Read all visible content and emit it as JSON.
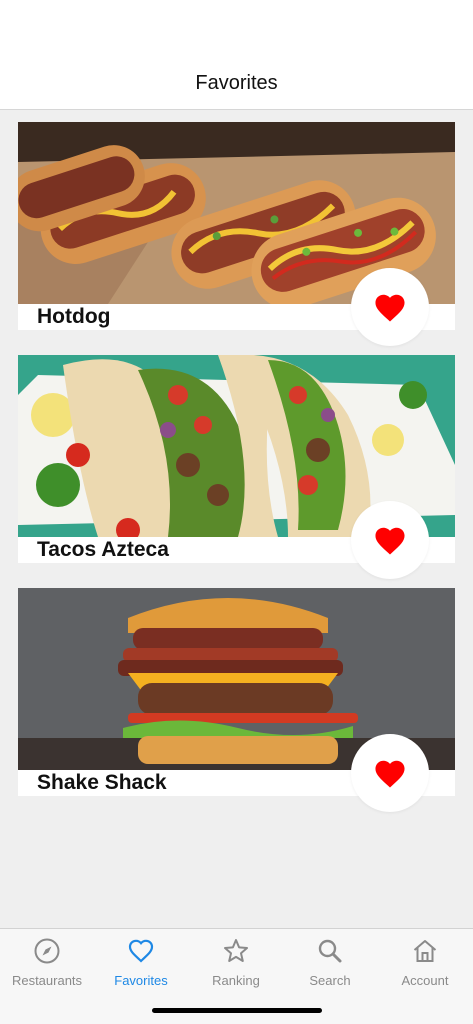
{
  "header": {
    "title": "Favorites"
  },
  "favorites": [
    {
      "name": "Hotdog",
      "favorite_icon": "heart-filled-icon"
    },
    {
      "name": "Tacos Azteca",
      "favorite_icon": "heart-filled-icon"
    },
    {
      "name": "Shake Shack",
      "favorite_icon": "heart-filled-icon"
    }
  ],
  "tabs": [
    {
      "label": "Restaurants",
      "icon": "compass-icon",
      "active": false
    },
    {
      "label": "Favorites",
      "icon": "heart-icon",
      "active": true
    },
    {
      "label": "Ranking",
      "icon": "star-icon",
      "active": false
    },
    {
      "label": "Search",
      "icon": "search-icon",
      "active": false
    },
    {
      "label": "Account",
      "icon": "home-icon",
      "active": false
    }
  ],
  "colors": {
    "accent": "#1e88e5",
    "heart": "#ff0000",
    "inactive": "#8a8a8a",
    "background": "#efefef"
  }
}
